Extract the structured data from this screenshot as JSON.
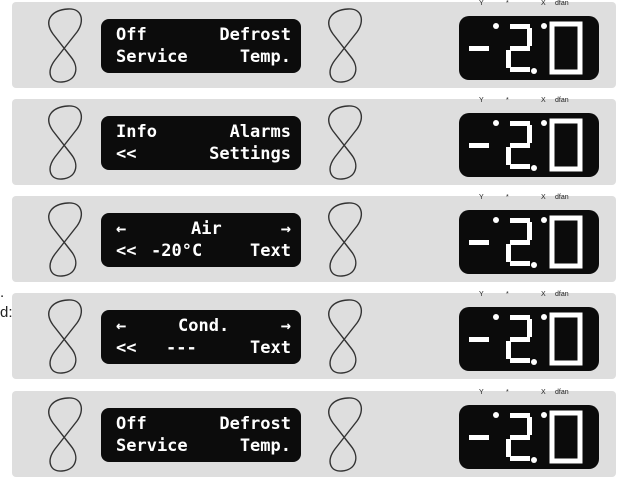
{
  "clipped_text": [
    ".",
    "d:"
  ],
  "status_icons": {
    "compressor": "Y",
    "fan": "*",
    "defrost": "X",
    "alarm": "dfan"
  },
  "temperature_display": "-20",
  "panels": [
    {
      "tl": "Off",
      "tr": "Defrost",
      "bl": "Service",
      "br": "Temp."
    },
    {
      "tl": "Info",
      "tr": "Alarms",
      "bl": "<<",
      "br": "Settings"
    },
    {
      "tl": "←",
      "tc": "Air",
      "tr": "→",
      "bl": "<<",
      "bc": "-20°C",
      "br": "Text"
    },
    {
      "tl": "←",
      "tc": "Cond.",
      "tr": "→",
      "bl": "<<",
      "bc": "---",
      "br": "Text"
    },
    {
      "tl": "Off",
      "tr": "Defrost",
      "bl": "Service",
      "br": "Temp."
    }
  ]
}
